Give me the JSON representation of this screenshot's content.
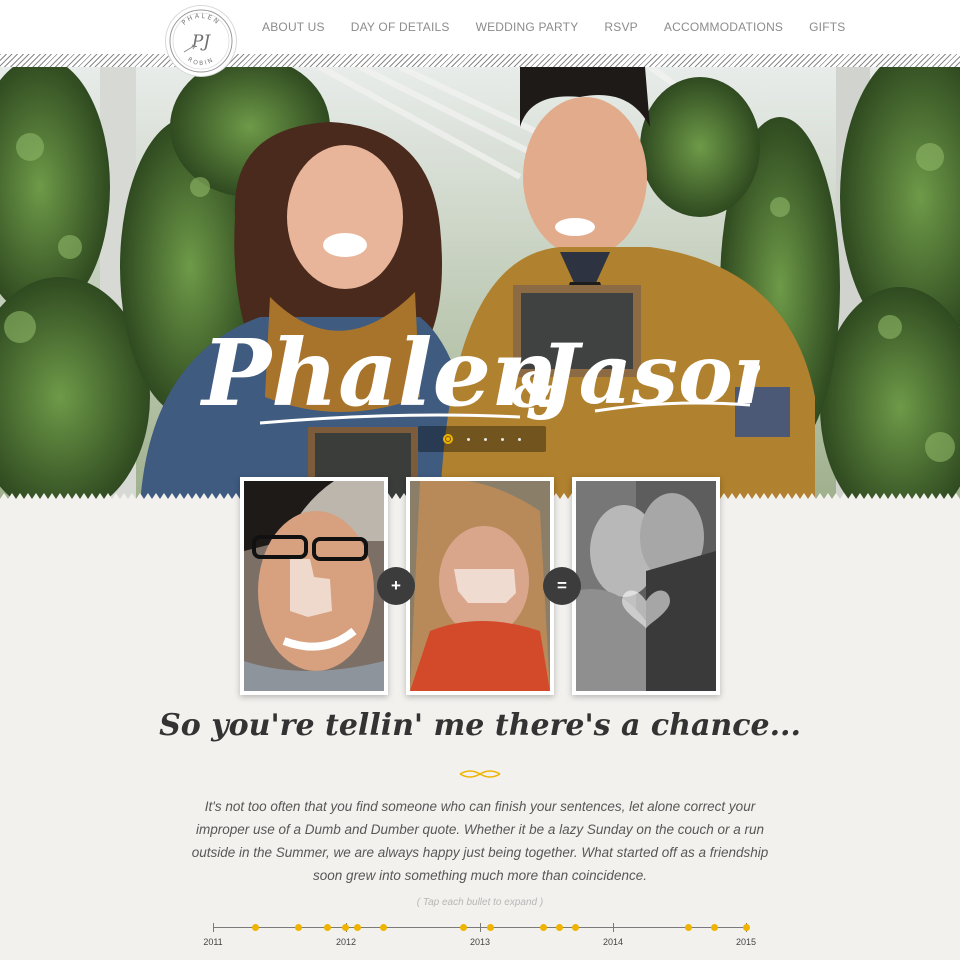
{
  "logo": {
    "top_text": "PHALEN",
    "bottom_text": "ROBIN",
    "monogram": "PJ"
  },
  "nav": {
    "items": [
      "ABOUT US",
      "DAY OF DETAILS",
      "WEDDING PARTY",
      "RSVP",
      "ACCOMMODATIONS",
      "GIFTS"
    ]
  },
  "hero": {
    "name_left": "Phalen",
    "ampersand": "&",
    "name_right": "Jason",
    "slide_count": 5,
    "active_slide": 1
  },
  "equation": {
    "plus": "+",
    "equals": "="
  },
  "story": {
    "title": "So you're tellin' me there's a chance...",
    "body": "It's not too often that you find someone who can finish your sentences, let alone correct your improper use of a Dumb and Dumber quote. Whether it be a lazy Sunday on the couch or a run outside in the Summer, we are always happy just being together. What started off as a friendship soon grew into something much more than coincidence.",
    "hint": "( Tap each bullet to expand )"
  },
  "timeline": {
    "years": [
      "2011",
      "2012",
      "2013",
      "2014",
      "2015"
    ],
    "accent_color": "#f0b400"
  },
  "colors": {
    "accent": "#f0b400",
    "title": "#333333",
    "nav_text": "#8c8c8c"
  }
}
